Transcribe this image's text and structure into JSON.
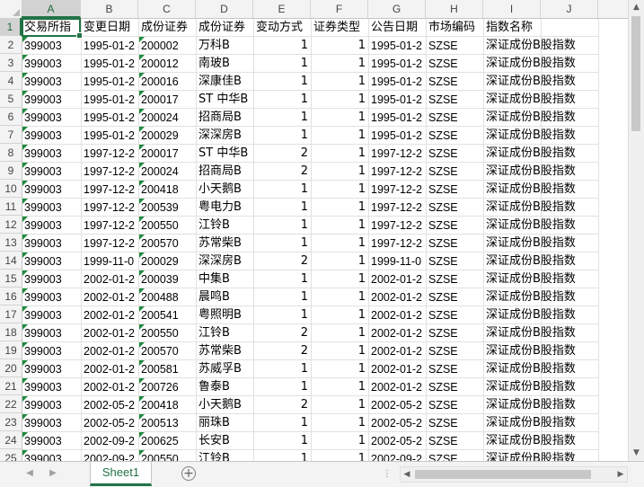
{
  "columns": [
    "A",
    "B",
    "C",
    "D",
    "E",
    "F",
    "G",
    "H",
    "I",
    "J"
  ],
  "selected_column": "A",
  "selected_row": "1",
  "row_numbers": [
    "1",
    "2",
    "3",
    "4",
    "5",
    "6",
    "7",
    "8",
    "9",
    "10",
    "11",
    "12",
    "13",
    "14",
    "15",
    "16",
    "17",
    "18",
    "19",
    "20",
    "21",
    "22",
    "23",
    "24",
    "25"
  ],
  "header_row": [
    "交易所指",
    "变更日期",
    "成份证券",
    "成份证券",
    "变动方式",
    "证券类型",
    "公告日期",
    "市场编码",
    "指数名称",
    ""
  ],
  "rows": [
    [
      "399003",
      "1995-01-2",
      "200002",
      "万科B",
      "1",
      "1",
      "1995-01-2",
      "SZSE",
      "深证成份B股指数"
    ],
    [
      "399003",
      "1995-01-2",
      "200012",
      "南玻B",
      "1",
      "1",
      "1995-01-2",
      "SZSE",
      "深证成份B股指数"
    ],
    [
      "399003",
      "1995-01-2",
      "200016",
      "深康佳B",
      "1",
      "1",
      "1995-01-2",
      "SZSE",
      "深证成份B股指数"
    ],
    [
      "399003",
      "1995-01-2",
      "200017",
      "ST 中华B",
      "1",
      "1",
      "1995-01-2",
      "SZSE",
      "深证成份B股指数"
    ],
    [
      "399003",
      "1995-01-2",
      "200024",
      "招商局B",
      "1",
      "1",
      "1995-01-2",
      "SZSE",
      "深证成份B股指数"
    ],
    [
      "399003",
      "1995-01-2",
      "200029",
      "深深房B",
      "1",
      "1",
      "1995-01-2",
      "SZSE",
      "深证成份B股指数"
    ],
    [
      "399003",
      "1997-12-2",
      "200017",
      "ST 中华B",
      "2",
      "1",
      "1997-12-2",
      "SZSE",
      "深证成份B股指数"
    ],
    [
      "399003",
      "1997-12-2",
      "200024",
      "招商局B",
      "2",
      "1",
      "1997-12-2",
      "SZSE",
      "深证成份B股指数"
    ],
    [
      "399003",
      "1997-12-2",
      "200418",
      "小天鹅B",
      "1",
      "1",
      "1997-12-2",
      "SZSE",
      "深证成份B股指数"
    ],
    [
      "399003",
      "1997-12-2",
      "200539",
      "粤电力B",
      "1",
      "1",
      "1997-12-2",
      "SZSE",
      "深证成份B股指数"
    ],
    [
      "399003",
      "1997-12-2",
      "200550",
      "江铃B",
      "1",
      "1",
      "1997-12-2",
      "SZSE",
      "深证成份B股指数"
    ],
    [
      "399003",
      "1997-12-2",
      "200570",
      "苏常柴B",
      "1",
      "1",
      "1997-12-2",
      "SZSE",
      "深证成份B股指数"
    ],
    [
      "399003",
      "1999-11-0",
      "200029",
      "深深房B",
      "2",
      "1",
      "1999-11-0",
      "SZSE",
      "深证成份B股指数"
    ],
    [
      "399003",
      "2002-01-2",
      "200039",
      "中集B",
      "1",
      "1",
      "2002-01-2",
      "SZSE",
      "深证成份B股指数"
    ],
    [
      "399003",
      "2002-01-2",
      "200488",
      "晨鸣B",
      "1",
      "1",
      "2002-01-2",
      "SZSE",
      "深证成份B股指数"
    ],
    [
      "399003",
      "2002-01-2",
      "200541",
      "粤照明B",
      "1",
      "1",
      "2002-01-2",
      "SZSE",
      "深证成份B股指数"
    ],
    [
      "399003",
      "2002-01-2",
      "200550",
      "江铃B",
      "2",
      "1",
      "2002-01-2",
      "SZSE",
      "深证成份B股指数"
    ],
    [
      "399003",
      "2002-01-2",
      "200570",
      "苏常柴B",
      "2",
      "1",
      "2002-01-2",
      "SZSE",
      "深证成份B股指数"
    ],
    [
      "399003",
      "2002-01-2",
      "200581",
      "苏威孚B",
      "1",
      "1",
      "2002-01-2",
      "SZSE",
      "深证成份B股指数"
    ],
    [
      "399003",
      "2002-01-2",
      "200726",
      "鲁泰B",
      "1",
      "1",
      "2002-01-2",
      "SZSE",
      "深证成份B股指数"
    ],
    [
      "399003",
      "2002-05-2",
      "200418",
      "小天鹅B",
      "2",
      "1",
      "2002-05-2",
      "SZSE",
      "深证成份B股指数"
    ],
    [
      "399003",
      "2002-05-2",
      "200513",
      "丽珠B",
      "1",
      "1",
      "2002-05-2",
      "SZSE",
      "深证成份B股指数"
    ],
    [
      "399003",
      "2002-09-2",
      "200625",
      "长安B",
      "1",
      "1",
      "2002-05-2",
      "SZSE",
      "深证成份B股指数"
    ],
    [
      "399003",
      "2002-09-2",
      "200550",
      "江铃B",
      "1",
      "1",
      "2002-09-2",
      "SZSE",
      "深证成份B股指数"
    ]
  ],
  "sheet_tab": "Sheet1",
  "accent_color": "#217346"
}
